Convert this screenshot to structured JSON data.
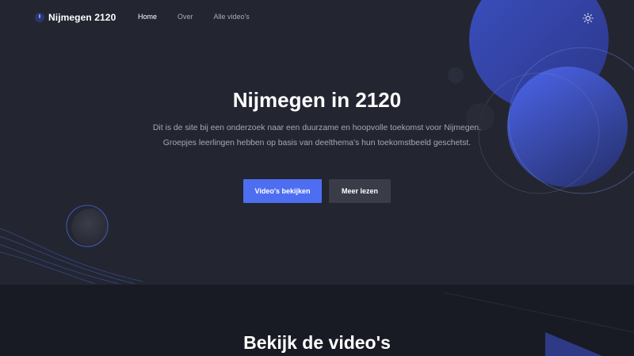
{
  "header": {
    "logo_text": "Nijmegen 2120",
    "nav": [
      {
        "label": "Home",
        "active": true
      },
      {
        "label": "Over",
        "active": false
      },
      {
        "label": "Alle video's",
        "active": false
      }
    ],
    "theme_icon": "sun-icon"
  },
  "hero": {
    "title": "Nijmegen in 2120",
    "description": "Dit is de site bij een onderzoek naar een duurzame en hoopvolle toekomst voor Nijmegen. Groepjes leerlingen hebben op basis van deelthema's hun toekomstbeeld geschetst.",
    "primary_button": "Video's bekijken",
    "secondary_button": "Meer lezen"
  },
  "videos_section": {
    "title": "Bekijk de video's"
  },
  "colors": {
    "background": "#232631",
    "section_background": "#191b24",
    "accent": "#4e6ef2",
    "secondary_button": "#3a3d48",
    "muted_text": "#a4a8b6"
  }
}
